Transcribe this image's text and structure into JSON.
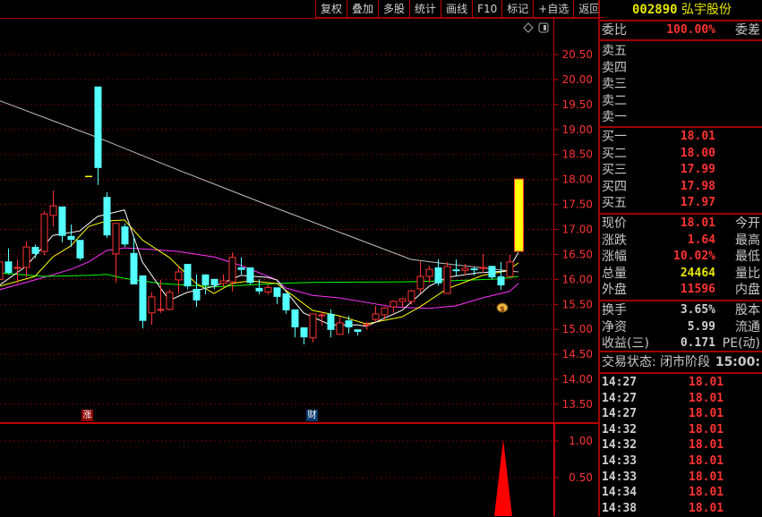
{
  "toolbar": {
    "buttons": [
      "复权",
      "叠加",
      "多股",
      "统计",
      "画线",
      "F10",
      "标记",
      "+自选",
      "返回"
    ]
  },
  "chart_icons": {
    "diamond": "diamond-icon",
    "toggle": "panel-toggle-icon",
    "bag": "money-bag-icon"
  },
  "markers": [
    {
      "label": "涨",
      "color": "#8b0000"
    },
    {
      "label": "财",
      "color": "#0a3a6a"
    }
  ],
  "colors": {
    "up": "#ff3333",
    "down": "#54ffff",
    "limit_up": "#ffff00",
    "ma1": "#ffffff",
    "ma2": "#ffff00",
    "ma3": "#ff33ff",
    "ma4": "#00ff00",
    "ma5": "#c0c0c0",
    "grid": "#c00000"
  },
  "chart_data": {
    "type": "candlestick",
    "yticks": [
      "20.50",
      "20.00",
      "19.50",
      "19.00",
      "18.50",
      "18.00",
      "17.50",
      "17.00",
      "16.50",
      "16.00",
      "15.50",
      "15.00",
      "14.50",
      "14.00",
      "13.50"
    ],
    "ylim": [
      13.5,
      20.5
    ],
    "candles": [
      [
        16.0,
        16.35,
        16.4,
        15.95
      ],
      [
        16.36,
        16.13,
        16.62,
        16.1
      ],
      [
        16.24,
        16.24,
        16.4,
        15.92
      ],
      [
        16.24,
        16.65,
        16.76,
        16.04
      ],
      [
        16.65,
        16.51,
        16.7,
        16.43
      ],
      [
        16.56,
        17.31,
        17.37,
        16.49
      ],
      [
        17.28,
        17.47,
        17.78,
        17.06
      ],
      [
        17.46,
        16.87,
        17.46,
        16.74
      ],
      [
        16.87,
        16.79,
        17.1,
        16.65
      ],
      [
        16.79,
        16.42,
        16.79,
        16.38
      ],
      [
        18.06,
        18.06,
        18.06,
        18.06
      ],
      [
        19.86,
        18.23,
        19.86,
        17.89
      ],
      [
        17.65,
        16.88,
        17.74,
        16.83
      ],
      [
        16.51,
        17.12,
        17.12,
        15.93
      ],
      [
        17.06,
        16.7,
        17.12,
        16.65
      ],
      [
        16.53,
        15.9,
        16.85,
        15.9
      ],
      [
        16.08,
        15.17,
        16.08,
        15.02
      ],
      [
        15.33,
        15.65,
        15.74,
        15.09
      ],
      [
        15.4,
        15.4,
        15.99,
        15.33
      ],
      [
        15.4,
        15.74,
        15.79,
        15.38
      ],
      [
        15.99,
        16.15,
        16.26,
        15.72
      ],
      [
        16.31,
        15.86,
        16.31,
        15.8
      ],
      [
        15.81,
        15.58,
        16.1,
        15.45
      ],
      [
        16.1,
        15.88,
        16.1,
        15.7
      ],
      [
        16.01,
        15.88,
        16.01,
        15.8
      ],
      [
        15.92,
        15.97,
        16.1,
        15.85
      ],
      [
        15.95,
        16.44,
        16.54,
        15.76
      ],
      [
        16.24,
        16.19,
        16.44,
        16.1
      ],
      [
        16.24,
        15.93,
        16.24,
        15.9
      ],
      [
        15.83,
        15.76,
        16.0,
        15.7
      ],
      [
        15.75,
        15.84,
        15.9,
        15.7
      ],
      [
        15.84,
        15.65,
        15.84,
        15.51
      ],
      [
        15.72,
        15.38,
        15.72,
        15.31
      ],
      [
        15.4,
        15.04,
        15.4,
        14.84
      ],
      [
        15.04,
        14.84,
        15.04,
        14.7
      ],
      [
        14.83,
        15.31,
        15.31,
        14.74
      ],
      [
        15.29,
        15.29,
        15.36,
        15.08
      ],
      [
        15.31,
        14.99,
        15.4,
        14.84
      ],
      [
        14.9,
        15.13,
        15.25,
        14.9
      ],
      [
        15.18,
        15.04,
        15.27,
        14.92
      ],
      [
        15.0,
        14.95,
        15.0,
        14.88
      ],
      [
        15.1,
        15.1,
        15.15,
        15.0
      ],
      [
        15.2,
        15.31,
        15.47,
        15.15
      ],
      [
        15.29,
        15.43,
        15.45,
        15.2
      ],
      [
        15.45,
        15.56,
        15.58,
        15.33
      ],
      [
        15.56,
        15.61,
        15.63,
        15.45
      ],
      [
        15.56,
        15.77,
        15.79,
        15.5
      ],
      [
        15.81,
        16.06,
        16.36,
        15.72
      ],
      [
        16.06,
        16.2,
        16.27,
        15.94
      ],
      [
        16.24,
        15.92,
        16.4,
        15.87
      ],
      [
        15.72,
        16.26,
        16.35,
        15.72
      ],
      [
        16.2,
        16.17,
        16.4,
        16.08
      ],
      [
        16.18,
        16.22,
        16.31,
        16.08
      ],
      [
        16.22,
        16.2,
        16.24,
        16.08
      ],
      [
        16.22,
        16.24,
        16.51,
        16.13
      ],
      [
        16.27,
        16.04,
        16.27,
        16.0
      ],
      [
        16.06,
        15.88,
        16.35,
        15.79
      ],
      [
        16.06,
        16.35,
        16.49,
        16.04
      ],
      [
        16.56,
        18.01,
        18.01,
        16.56
      ]
    ],
    "ma_lines": [
      {
        "color": "#c0c0c0",
        "points": [
          [
            0,
            19.58
          ],
          [
            11,
            18.84
          ],
          [
            20,
            18.19
          ],
          [
            30,
            17.49
          ],
          [
            46,
            16.4
          ],
          [
            50,
            16.31
          ],
          [
            58,
            16.15
          ]
        ]
      },
      {
        "color": "#ff33ff",
        "points": [
          [
            0,
            15.79
          ],
          [
            5,
            16.04
          ],
          [
            8,
            16.2
          ],
          [
            10,
            16.35
          ],
          [
            12,
            16.58
          ],
          [
            14,
            16.63
          ],
          [
            17,
            16.6
          ],
          [
            20,
            16.56
          ],
          [
            24,
            16.45
          ],
          [
            27,
            16.28
          ],
          [
            31,
            15.99
          ],
          [
            32,
            15.83
          ],
          [
            35,
            15.68
          ],
          [
            38,
            15.63
          ],
          [
            41,
            15.54
          ],
          [
            44,
            15.45
          ],
          [
            48,
            15.42
          ],
          [
            51,
            15.47
          ],
          [
            54,
            15.63
          ],
          [
            57,
            15.76
          ],
          [
            58,
            15.92
          ]
        ]
      },
      {
        "color": "#00ff00",
        "points": [
          [
            0,
            16.13
          ],
          [
            5,
            16.06
          ],
          [
            10,
            16.08
          ],
          [
            12,
            16.1
          ],
          [
            14,
            16.02
          ],
          [
            18,
            15.92
          ],
          [
            24,
            15.85
          ],
          [
            31,
            15.92
          ],
          [
            35,
            15.94
          ],
          [
            45,
            15.95
          ],
          [
            50,
            15.97
          ],
          [
            56,
            16.01
          ],
          [
            58,
            16.06
          ]
        ]
      },
      {
        "color": "#ffff00",
        "points": [
          [
            0,
            15.86
          ],
          [
            4,
            16.06
          ],
          [
            6,
            16.45
          ],
          [
            8,
            16.67
          ],
          [
            10,
            17.06
          ],
          [
            12,
            17.17
          ],
          [
            14,
            17.19
          ],
          [
            16,
            16.79
          ],
          [
            19,
            16.44
          ],
          [
            22,
            15.92
          ],
          [
            24,
            15.72
          ],
          [
            26,
            15.92
          ],
          [
            28,
            15.97
          ],
          [
            31,
            15.92
          ],
          [
            35,
            15.38
          ],
          [
            38,
            15.27
          ],
          [
            41,
            15.11
          ],
          [
            45,
            15.25
          ],
          [
            47,
            15.45
          ],
          [
            50,
            15.81
          ],
          [
            54,
            16.08
          ],
          [
            56.7,
            16.17
          ],
          [
            58,
            16.33
          ]
        ]
      },
      {
        "color": "#ffffff",
        "points": [
          [
            0,
            15.88
          ],
          [
            3,
            16.26
          ],
          [
            6,
            16.88
          ],
          [
            9,
            16.97
          ],
          [
            11,
            17.26
          ],
          [
            14,
            17.39
          ],
          [
            16,
            16.35
          ],
          [
            19,
            15.58
          ],
          [
            21,
            15.74
          ],
          [
            24,
            15.86
          ],
          [
            27,
            16.08
          ],
          [
            30,
            16.04
          ],
          [
            31,
            15.99
          ],
          [
            34,
            15.33
          ],
          [
            37,
            15.09
          ],
          [
            40,
            15.09
          ],
          [
            41,
            15.06
          ],
          [
            45,
            15.38
          ],
          [
            48,
            15.86
          ],
          [
            50,
            16.04
          ],
          [
            53.4,
            16.13
          ],
          [
            56.8,
            16.17
          ],
          [
            58,
            16.54
          ]
        ]
      }
    ],
    "sub_yticks": [
      "1.00",
      "0.50"
    ],
    "sub_ylim": [
      0,
      1.0
    ],
    "sub_spike": {
      "candle": 56.3,
      "value": 1.02
    }
  },
  "quote": {
    "code": "002890",
    "name": "弘宇股份",
    "weibi_label": "委比",
    "weibi_value": "100.00%",
    "weicha_label": "委差",
    "sell": [
      "卖五",
      "卖四",
      "卖三",
      "卖二",
      "卖一"
    ],
    "buy": [
      {
        "l": "买一",
        "v": "18.01"
      },
      {
        "l": "买二",
        "v": "18.00"
      },
      {
        "l": "买三",
        "v": "17.99"
      },
      {
        "l": "买四",
        "v": "17.98"
      },
      {
        "l": "买五",
        "v": "17.97"
      }
    ],
    "stats": [
      {
        "l": "现价",
        "v": "18.01",
        "r": "今开",
        "c": "red"
      },
      {
        "l": "涨跌",
        "v": "1.64",
        "r": "最高",
        "c": "red"
      },
      {
        "l": "涨幅",
        "v": "10.02%",
        "r": "最低",
        "c": "red"
      },
      {
        "l": "总量",
        "v": "24464",
        "r": "量比",
        "c": "yel"
      },
      {
        "l": "外盘",
        "v": "11596",
        "r": "内盘",
        "c": "red"
      }
    ],
    "fund": [
      {
        "l": "换手",
        "v": "3.65%",
        "r": "股本"
      },
      {
        "l": "净资",
        "v": "5.99",
        "r": "流通"
      },
      {
        "l": "收益(三)",
        "v": "0.171",
        "r": "PE(动)"
      }
    ],
    "status_label": "交易状态: 闭市阶段",
    "status_time": "15:00:",
    "ticks": [
      {
        "t": "14:27",
        "p": "18.01"
      },
      {
        "t": "14:27",
        "p": "18.01"
      },
      {
        "t": "14:27",
        "p": "18.01"
      },
      {
        "t": "14:32",
        "p": "18.01"
      },
      {
        "t": "14:32",
        "p": "18.01"
      },
      {
        "t": "14:33",
        "p": "18.01"
      },
      {
        "t": "14:33",
        "p": "18.01"
      },
      {
        "t": "14:34",
        "p": "18.01"
      },
      {
        "t": "14:38",
        "p": "18.01"
      }
    ]
  }
}
